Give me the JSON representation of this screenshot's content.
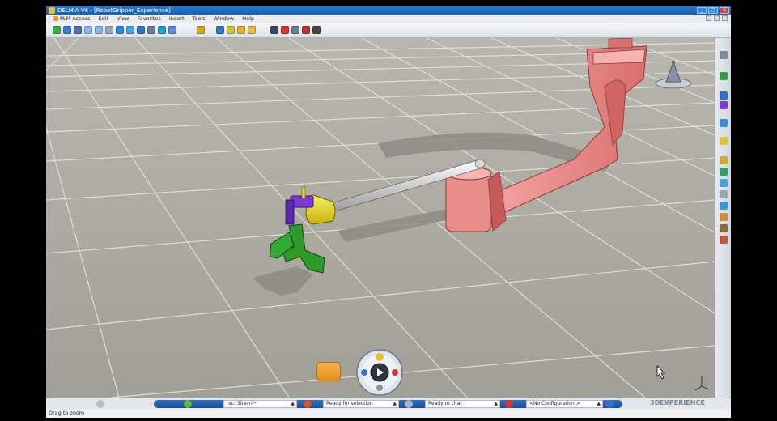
{
  "window": {
    "title": "DELMIA V6 - [RobotGripper_Experience]",
    "buttons": [
      "_",
      "□",
      "×"
    ]
  },
  "menu": {
    "items": [
      "PLM Access",
      "Edit",
      "View",
      "Favorites",
      "Insert",
      "Tools",
      "Window",
      "Help"
    ]
  },
  "toolbar": {
    "view_tools": [
      "fit-all-icon",
      "pan-icon",
      "rotate-icon",
      "zoom-in-icon",
      "zoom-out-icon",
      "normal-view-icon",
      "multi-view-icon",
      "iso-view-icon",
      "view-mode-icon",
      "hide-show-icon",
      "swap-visible-icon",
      "material-icon"
    ],
    "extra_tools": [
      "catalog-icon",
      "select-icon",
      "measure-icon",
      "analysis-icon",
      "snapshot-icon",
      "simulation-icon",
      "record-icon",
      "kinematics-icon",
      "robot-icon",
      "camera-icon"
    ]
  },
  "status": {
    "configuration": "<No Configuration >",
    "ready_selection": "Ready for selection",
    "ready_chat": "Ready to chat",
    "search_field": "rsc: 30avril*",
    "brand": "3DEXPERIENCE"
  },
  "prompt": "Drag to zoom",
  "colors": {
    "floor": "#bdbab1",
    "grid": "#dedcd6",
    "robot_arm": "#e88a88",
    "gripper_jaws": "#2d9a2a",
    "gripper_clamp": "#7a3ad0",
    "gripper_body": "#f0e11c",
    "shaft": "#e8e8e8"
  }
}
